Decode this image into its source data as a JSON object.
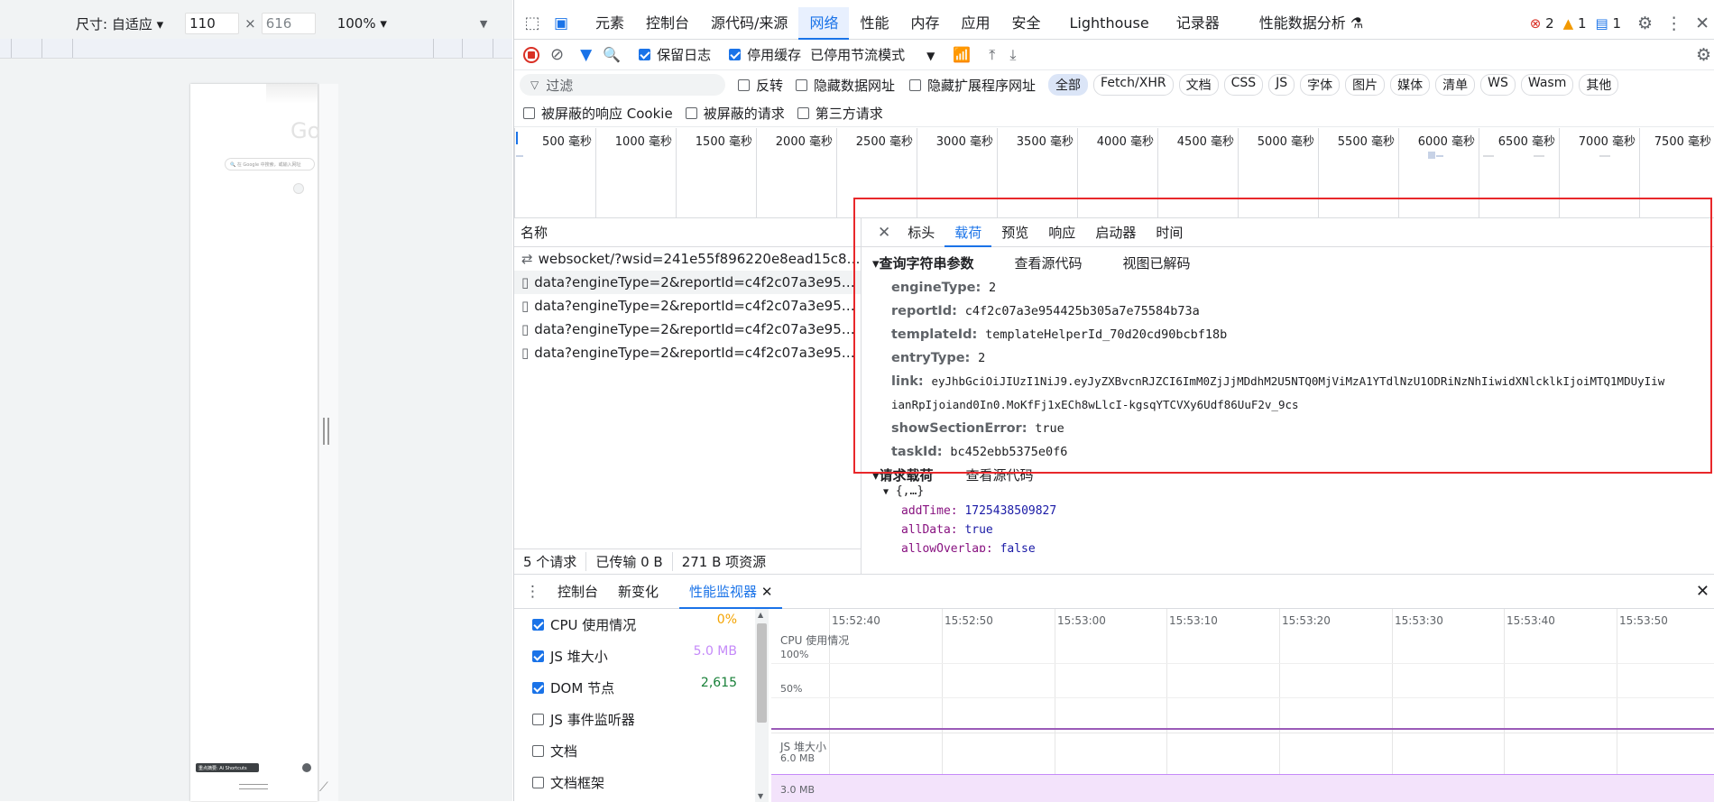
{
  "device_toolbar": {
    "size_label": "尺寸: 自适应",
    "width": "110",
    "times": "×",
    "height": "616",
    "zoom": "100%"
  },
  "phone": {
    "search_placeholder": "在 Google 中搜索，或输入网址",
    "logo_text": "Go",
    "bottom_text": "重点摘要: Ai Shortcuts"
  },
  "devtools_tabs": [
    "元素",
    "控制台",
    "源代码/来源",
    "网络",
    "性能",
    "内存",
    "应用",
    "安全",
    "Lighthouse",
    "记录器",
    "性能数据分析"
  ],
  "badges": {
    "errors": "2",
    "warnings": "1",
    "info": "1"
  },
  "netbar": {
    "preserve_log": "保留日志",
    "disable_cache": "停用缓存",
    "throttle": "已停用节流模式"
  },
  "filter": {
    "placeholder": "过滤",
    "invert": "反转",
    "hide_data_urls": "隐藏数据网址",
    "hide_ext_urls": "隐藏扩展程序网址",
    "chips": [
      "全部",
      "Fetch/XHR",
      "文档",
      "CSS",
      "JS",
      "字体",
      "图片",
      "媒体",
      "清单",
      "WS",
      "Wasm",
      "其他"
    ],
    "blocked_cookies": "被屏蔽的响应 Cookie",
    "blocked_requests": "被屏蔽的请求",
    "third_party": "第三方请求"
  },
  "timeline_ticks": [
    "500 毫秒",
    "1000 毫秒",
    "1500 毫秒",
    "2000 毫秒",
    "2500 毫秒",
    "3000 毫秒",
    "3500 毫秒",
    "4000 毫秒",
    "4500 毫秒",
    "5000 毫秒",
    "5500 毫秒",
    "6000 毫秒",
    "6500 毫秒",
    "7000 毫秒",
    "7500 毫秒"
  ],
  "request_list": {
    "header": "名称",
    "items": [
      "websocket/?wsid=241e55f896220e8ead15c815...",
      "data?engineType=2&reportId=c4f2c07a3e954...",
      "data?engineType=2&reportId=c4f2c07a3e954...",
      "data?engineType=2&reportId=c4f2c07a3e954...",
      "data?engineType=2&reportId=c4f2c07a3e954..."
    ],
    "status": [
      "5 个请求",
      "已传输 0 B",
      "271 B 项资源"
    ]
  },
  "detail_tabs": [
    "标头",
    "载荷",
    "预览",
    "响应",
    "启动器",
    "时间"
  ],
  "query_section": {
    "title": "▾查询字符串参数",
    "view_source": "查看源代码",
    "view_decoded": "视图已解码",
    "params": [
      {
        "key": "engineType:",
        "value": "2"
      },
      {
        "key": "reportId:",
        "value": "c4f2c07a3e954425b305a7e75584b73a"
      },
      {
        "key": "templateId:",
        "value": "templateHelperId_70d20cd90bcbf18b"
      },
      {
        "key": "entryType:",
        "value": "2"
      },
      {
        "key": "link:",
        "value": "eyJhbGciOiJIUzI1NiJ9.eyJyZXBvcnRJZCI6ImM0ZjJjMDdhM2U5NTQ0MjViMzA1YTdlNzU1ODRiNzNhIiwidXNlcklkIjoiMTQ1MDUyIiw"
      },
      {
        "key": "",
        "value": "ianRpIjoiand0In0.MoKfFj1xECh8wLlcI-kgsqYTCVXy6Udf86UuF2v_9cs"
      },
      {
        "key": "showSectionError:",
        "value": "true"
      },
      {
        "key": "taskId:",
        "value": "bc452ebb5375e0f6"
      }
    ]
  },
  "payload_section": {
    "title": "▾请求载荷",
    "view_source": "查看源代码",
    "root": "{,…}",
    "fields": [
      {
        "key": "addTime:",
        "value": "1725438509827"
      },
      {
        "key": "allData:",
        "value": "true"
      },
      {
        "key": "allowOverlap:",
        "value": "false"
      }
    ]
  },
  "drawer": {
    "tabs": [
      "控制台",
      "新变化",
      "性能监视器"
    ],
    "metrics": [
      {
        "label": "CPU 使用情况",
        "value": "0%",
        "checked": true,
        "color": "#f4a300"
      },
      {
        "label": "JS 堆大小",
        "value": "5.0 MB",
        "checked": true,
        "color": "#c58af9"
      },
      {
        "label": "DOM 节点",
        "value": "2,615",
        "checked": true,
        "color": "#188038"
      },
      {
        "label": "JS 事件监听器",
        "value": "",
        "checked": false,
        "color": "#202124"
      },
      {
        "label": "文档",
        "value": "",
        "checked": false,
        "color": "#202124"
      },
      {
        "label": "文档框架",
        "value": "",
        "checked": false,
        "color": "#202124"
      }
    ],
    "chart_times": [
      "15:52:40",
      "15:52:50",
      "15:53:00",
      "15:53:10",
      "15:53:20",
      "15:53:30",
      "15:53:40",
      "15:53:50"
    ],
    "cpu_label": "CPU 使用情况",
    "cpu_100": "100%",
    "cpu_50": "50%",
    "js_label": "JS 堆大小",
    "js_6": "6.0 MB",
    "js_3": "3.0 MB"
  }
}
